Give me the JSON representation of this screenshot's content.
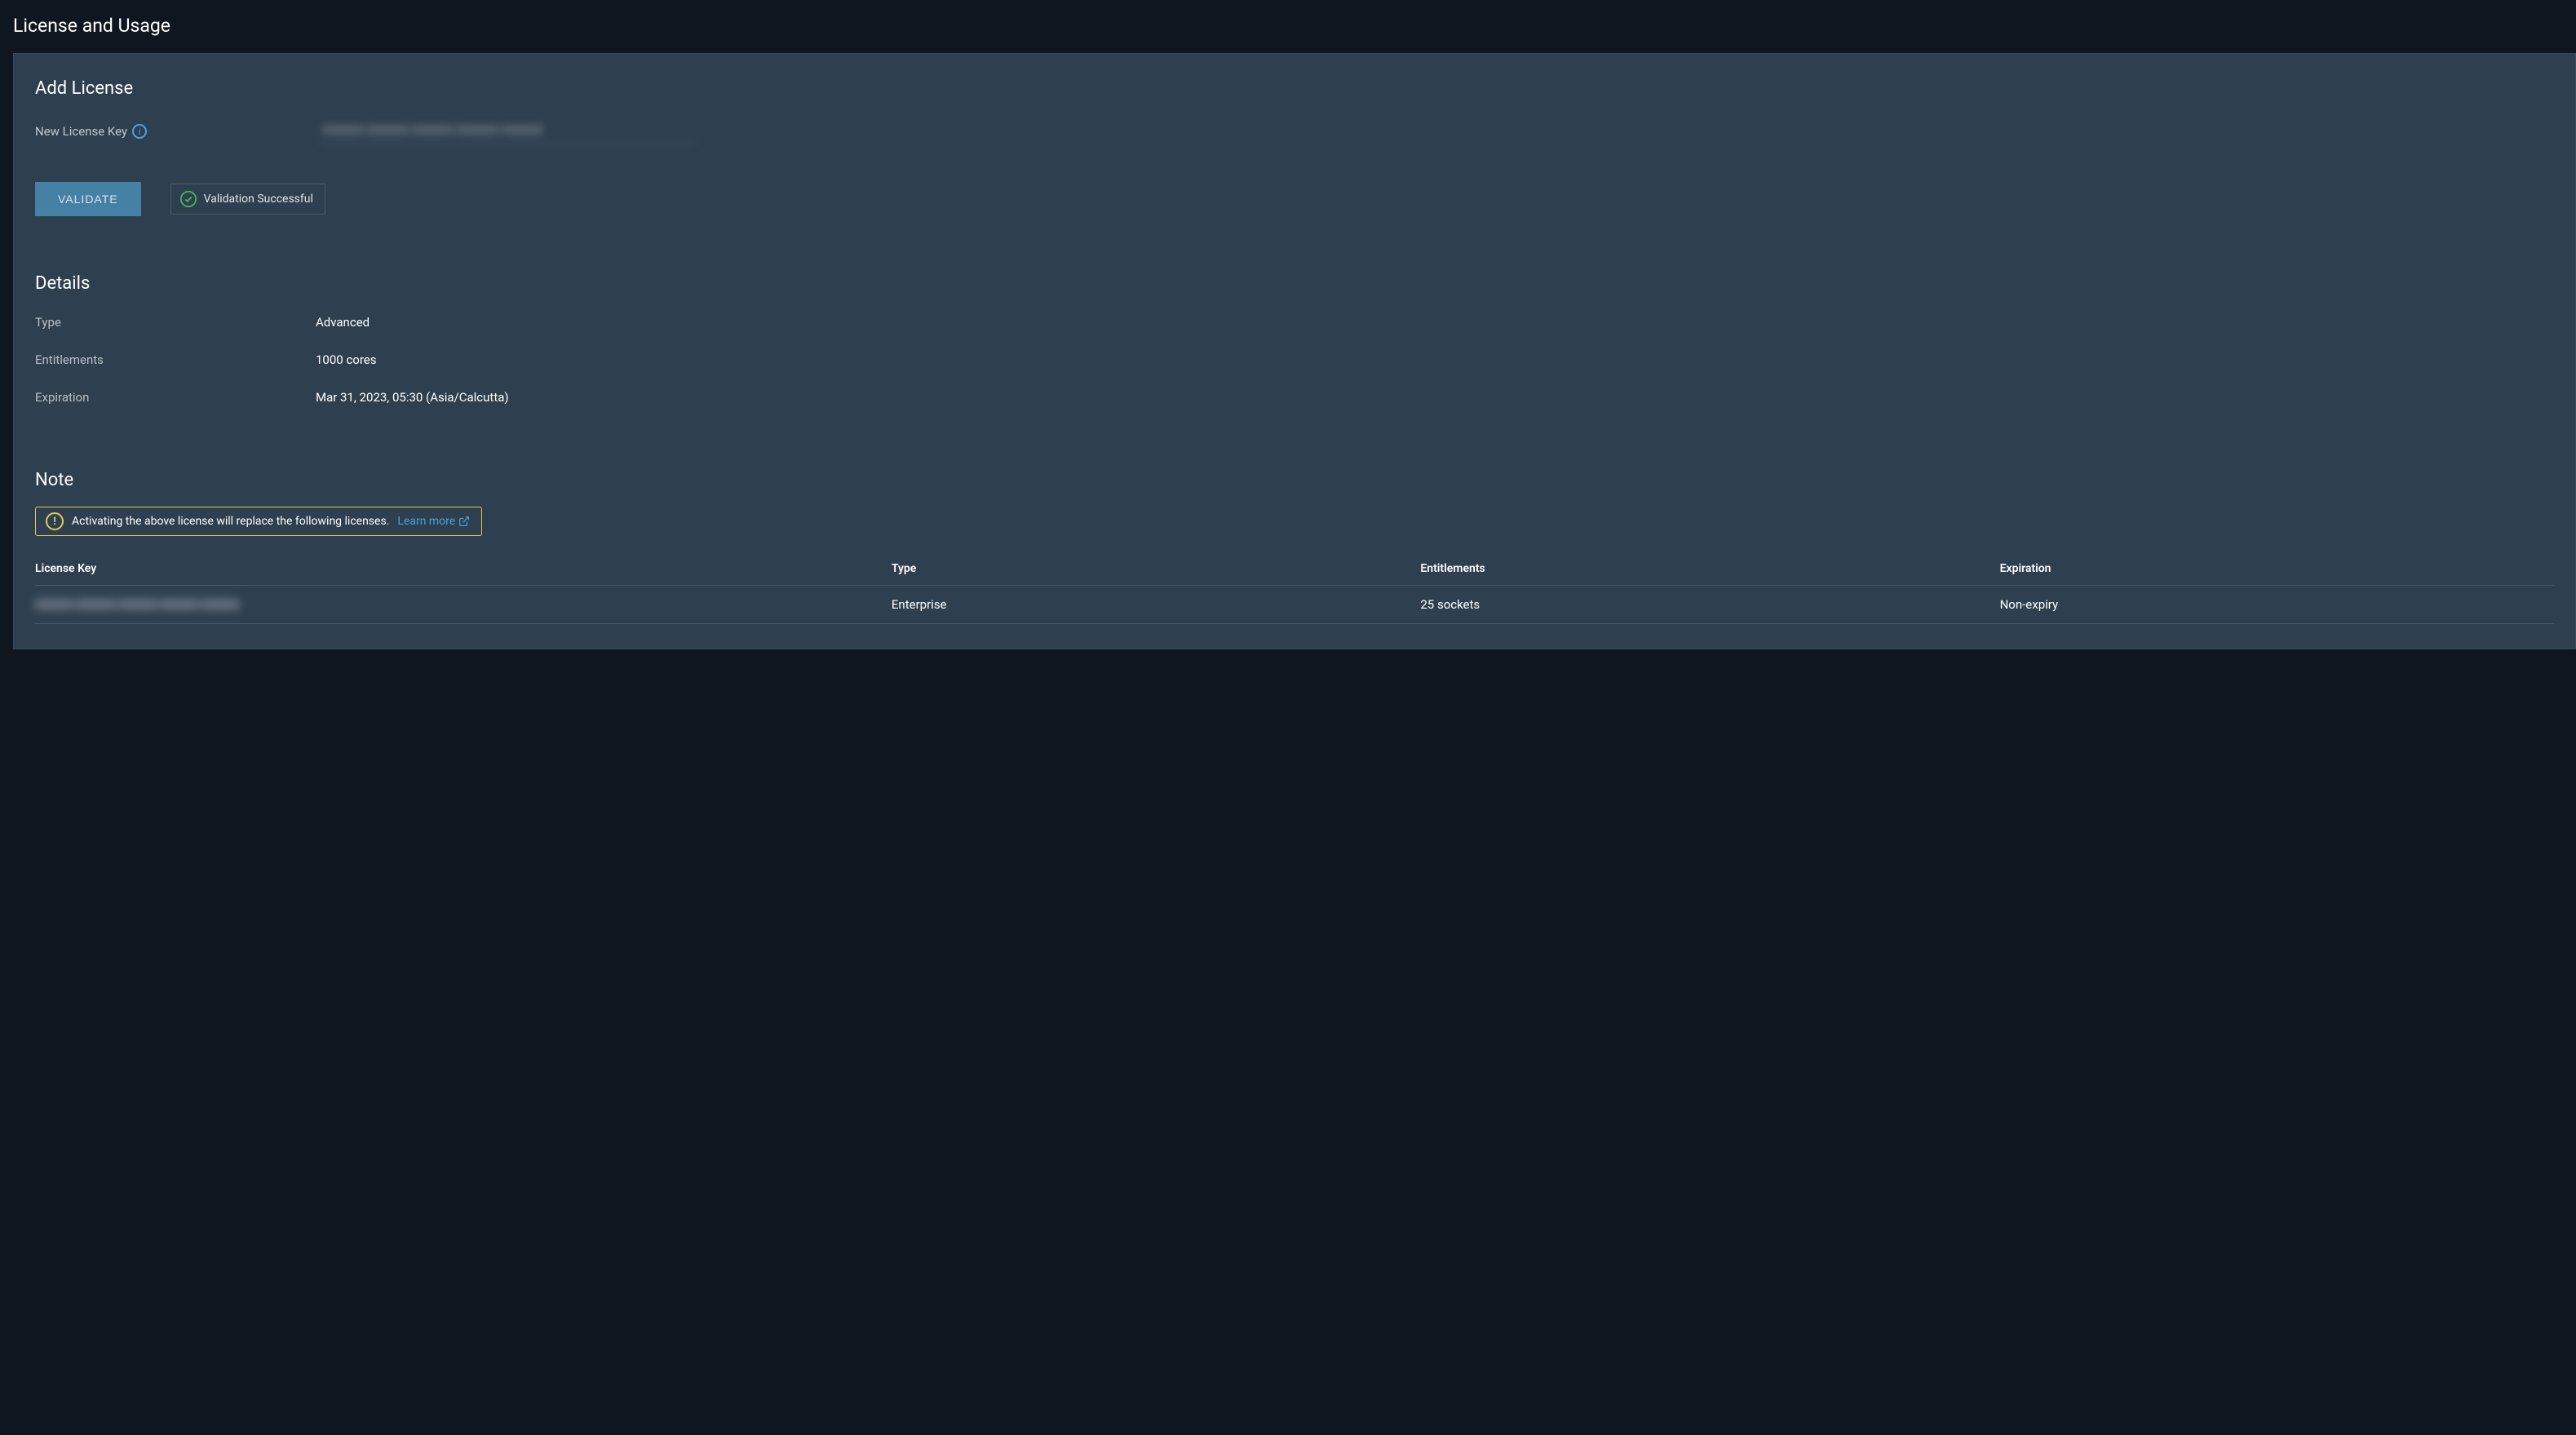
{
  "page": {
    "title": "License and Usage"
  },
  "addLicense": {
    "header": "Add License",
    "keyLabel": "New License Key",
    "keyValue": "XXXXX-XXXXX-XXXXX-XXXXX-XXXXX",
    "validateLabel": "VALIDATE",
    "validationStatus": "Validation Successful"
  },
  "details": {
    "header": "Details",
    "typeLabel": "Type",
    "typeValue": "Advanced",
    "entitlementsLabel": "Entitlements",
    "entitlementsValue": "1000 cores",
    "expirationLabel": "Expiration",
    "expirationValue": "Mar 31, 2023, 05:30 (Asia/Calcutta)"
  },
  "note": {
    "header": "Note",
    "message": "Activating the above license will replace the following licenses.",
    "learnMore": "Learn more"
  },
  "table": {
    "headers": {
      "key": "License Key",
      "type": "Type",
      "entitlements": "Entitlements",
      "expiration": "Expiration"
    },
    "rows": [
      {
        "key": "XXXXX-XXXXX-XXXXX-XXXXX-XXXXX",
        "type": "Enterprise",
        "entitlements": "25 sockets",
        "expiration": "Non-expiry"
      }
    ]
  }
}
